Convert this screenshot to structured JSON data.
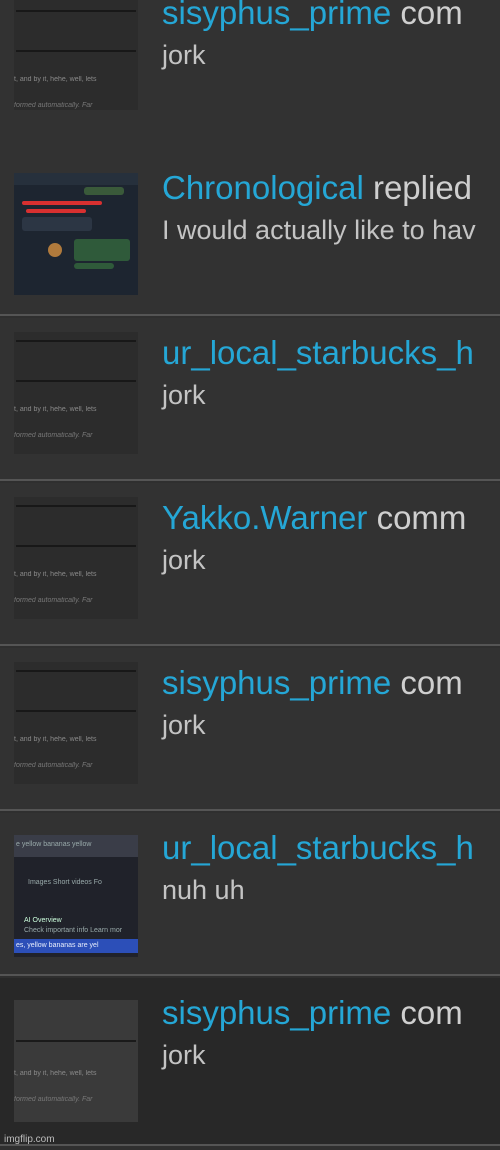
{
  "notifications": [
    {
      "username": "sisyphus_prime",
      "action": " com",
      "text": "jork",
      "thumbnail": "text-snippet"
    },
    {
      "username": "Chronological",
      "action": " replied",
      "text": "I would actually like to hav",
      "thumbnail": "chat-screenshot"
    },
    {
      "username": "ur_local_starbucks_h",
      "action": "",
      "text": "jork",
      "thumbnail": "text-snippet"
    },
    {
      "username": "Yakko.Warner",
      "action": " comm",
      "text": "jork",
      "thumbnail": "text-snippet"
    },
    {
      "username": "sisyphus_prime",
      "action": " com",
      "text": "jork",
      "thumbnail": "text-snippet"
    },
    {
      "username": "ur_local_starbucks_h",
      "action": "",
      "text": "nuh uh",
      "thumbnail": "search-screenshot"
    },
    {
      "username": "sisyphus_prime",
      "action": " com",
      "text": "jork",
      "thumbnail": "text-snippet"
    }
  ],
  "thumb_text": {
    "line1": "t, and by it, hehe, well, lets",
    "line2": "formed automatically. Far"
  },
  "search_thumb": {
    "query": "e yellow bananas yellow",
    "tabs": "Images    Short videos    Fo",
    "ai_title": "AI Overview",
    "ai_sub": "Check important info  Learn mor",
    "result": "es, yellow bananas are yel"
  },
  "watermark": "imgflip.com",
  "colors": {
    "username": "#25a7d6",
    "background": "#323232",
    "divider": "#555555"
  }
}
